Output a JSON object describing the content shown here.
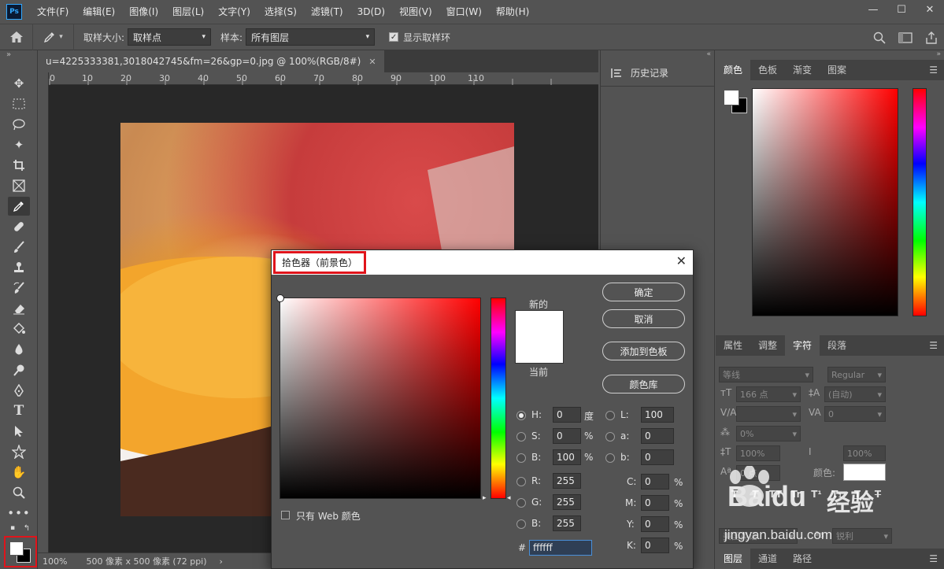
{
  "menubar": {
    "app_icon": "Ps",
    "items": [
      "文件(F)",
      "编辑(E)",
      "图像(I)",
      "图层(L)",
      "文字(Y)",
      "选择(S)",
      "滤镜(T)",
      "3D(D)",
      "视图(V)",
      "窗口(W)",
      "帮助(H)"
    ],
    "window_controls": [
      "—",
      "☐",
      "✕"
    ]
  },
  "options": {
    "sample_size_label": "取样大小:",
    "sample_size_value": "取样点",
    "sample_label": "样本:",
    "sample_value": "所有图层",
    "show_ring_label": "显示取样环"
  },
  "document": {
    "tab_title": "u=4225333381,3018042745&fm=26&gp=0.jpg @ 100%(RGB/8#)",
    "ruler_labels": [
      "0",
      "10",
      "20",
      "30",
      "40",
      "50",
      "60",
      "70",
      "80",
      "90",
      "100",
      "110"
    ],
    "zoom": "100%",
    "doc_size": "500 像素 x 500 像素 (72 ppi)"
  },
  "mid_panel": {
    "history_label": "历史记录"
  },
  "right_panel": {
    "color_tabs": [
      "颜色",
      "色板",
      "渐变",
      "图案"
    ],
    "char_tabs": [
      "属性",
      "调整",
      "字符",
      "段落"
    ],
    "font_family": "等线",
    "font_style": "Regular",
    "font_size": "166 点",
    "leading": "(自动)",
    "kerning": "",
    "tracking": "0",
    "scale_pct": "0%",
    "vscale": "100%",
    "hscale": "100%",
    "baseline": "0 点",
    "color_label": "颜色:",
    "language": "美国英语",
    "antialias": "锐利",
    "bottom_tabs": [
      "图层",
      "通道",
      "路径"
    ]
  },
  "dialog": {
    "title": "拾色器（前景色）",
    "new_label": "新的",
    "current_label": "当前",
    "ok": "确定",
    "cancel": "取消",
    "add_swatch": "添加到色板",
    "color_libs": "颜色库",
    "web_only": "只有 Web 颜色",
    "h_label": "H:",
    "h_val": "0",
    "h_unit": "度",
    "s_label": "S:",
    "s_val": "0",
    "s_unit": "%",
    "b_label": "B:",
    "b_val": "100",
    "b_unit": "%",
    "r_label": "R:",
    "r_val": "255",
    "g_label": "G:",
    "g_val": "255",
    "bb_label": "B:",
    "bb_val": "255",
    "l_label": "L:",
    "l_val": "100",
    "a_label": "a:",
    "a_val": "0",
    "lb_label": "b:",
    "lb_val": "0",
    "c_label": "C:",
    "c_val": "0",
    "m_label": "M:",
    "m_val": "0",
    "y_label": "Y:",
    "y_val": "0",
    "k_label": "K:",
    "k_val": "0",
    "pct": "%",
    "hash": "#",
    "hex": "ffffff"
  },
  "watermark": {
    "brand": "Baidu",
    "sub": "经验",
    "url": "jingyan.baidu.com"
  }
}
